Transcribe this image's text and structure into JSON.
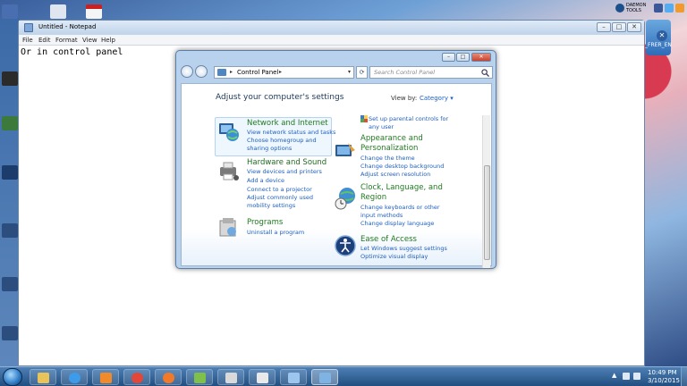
{
  "notepad": {
    "title": "Untitled - Notepad",
    "menu": [
      "File",
      "Edit",
      "Format",
      "View",
      "Help"
    ],
    "text": "Or in control panel",
    "controls": [
      "–",
      "□",
      "✕"
    ]
  },
  "control_panel": {
    "address_root": "Control Panel",
    "search_placeholder": "Search Control Panel",
    "heading": "Adjust your computer's settings",
    "view_by_label": "View by:",
    "view_by_value": "Category ▾",
    "categories": [
      {
        "title": "Network and Internet",
        "links": [
          "View network status and tasks",
          "Choose homegroup and",
          "sharing options"
        ]
      },
      {
        "title": "Hardware and Sound",
        "links": [
          "View devices and printers",
          "Add a device",
          "Connect to a projector",
          "Adjust commonly used",
          "mobility settings"
        ]
      },
      {
        "title": "Programs",
        "links": [
          "Uninstall a program"
        ]
      },
      {
        "title": "",
        "links": [
          "Set up parental controls for",
          "any user"
        ]
      },
      {
        "title_line1": "Appearance and",
        "title_line2": "Personalization",
        "links": [
          "Change the theme",
          "Change desktop background",
          "Adjust screen resolution"
        ]
      },
      {
        "title_line1": "Clock, Language, and",
        "title_line2": "Region",
        "links": [
          "Change keyboards or other",
          "input methods",
          "Change display language"
        ]
      },
      {
        "title": "Ease of Access",
        "links": [
          "Let Windows suggest settings",
          "Optimize visual display"
        ]
      }
    ]
  },
  "gadget": {
    "close": "✕",
    "label": "_FRER_EN"
  },
  "tray_top": {
    "daemon_label_1": "DAEMON",
    "daemon_label_2": "TOOLS"
  },
  "taskbar": {
    "time": "10:49 PM",
    "date": "3/10/2015",
    "tray_arrow": "▲"
  },
  "colors": {
    "link": "#1e5fbf",
    "category_title": "#1f7a1f",
    "taskbar": "#2a5a90"
  }
}
